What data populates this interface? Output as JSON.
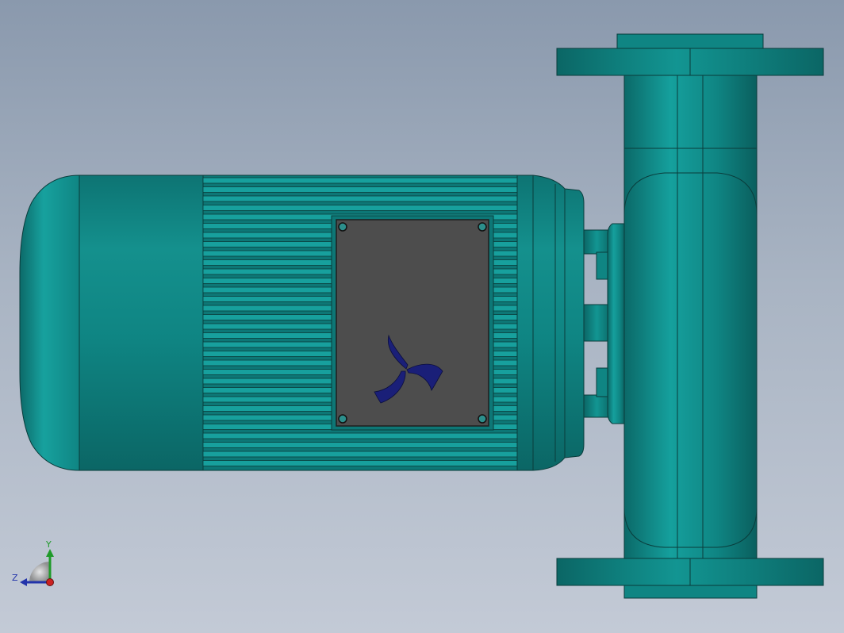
{
  "viewport": {
    "background_top": "#8a99ad",
    "background_bottom": "#c3cad6"
  },
  "model": {
    "body_color": "#0f8583",
    "body_highlight": "#19a6a3",
    "body_shadow": "#0a5f5e",
    "nameplate_color": "#4d4d4d",
    "logo_color": "#1a1f78"
  },
  "triad": {
    "y_label": "Y",
    "z_label": "Z",
    "y_color": "#1f9a2a",
    "z_color": "#2233aa",
    "origin_color": "#cc2222"
  }
}
